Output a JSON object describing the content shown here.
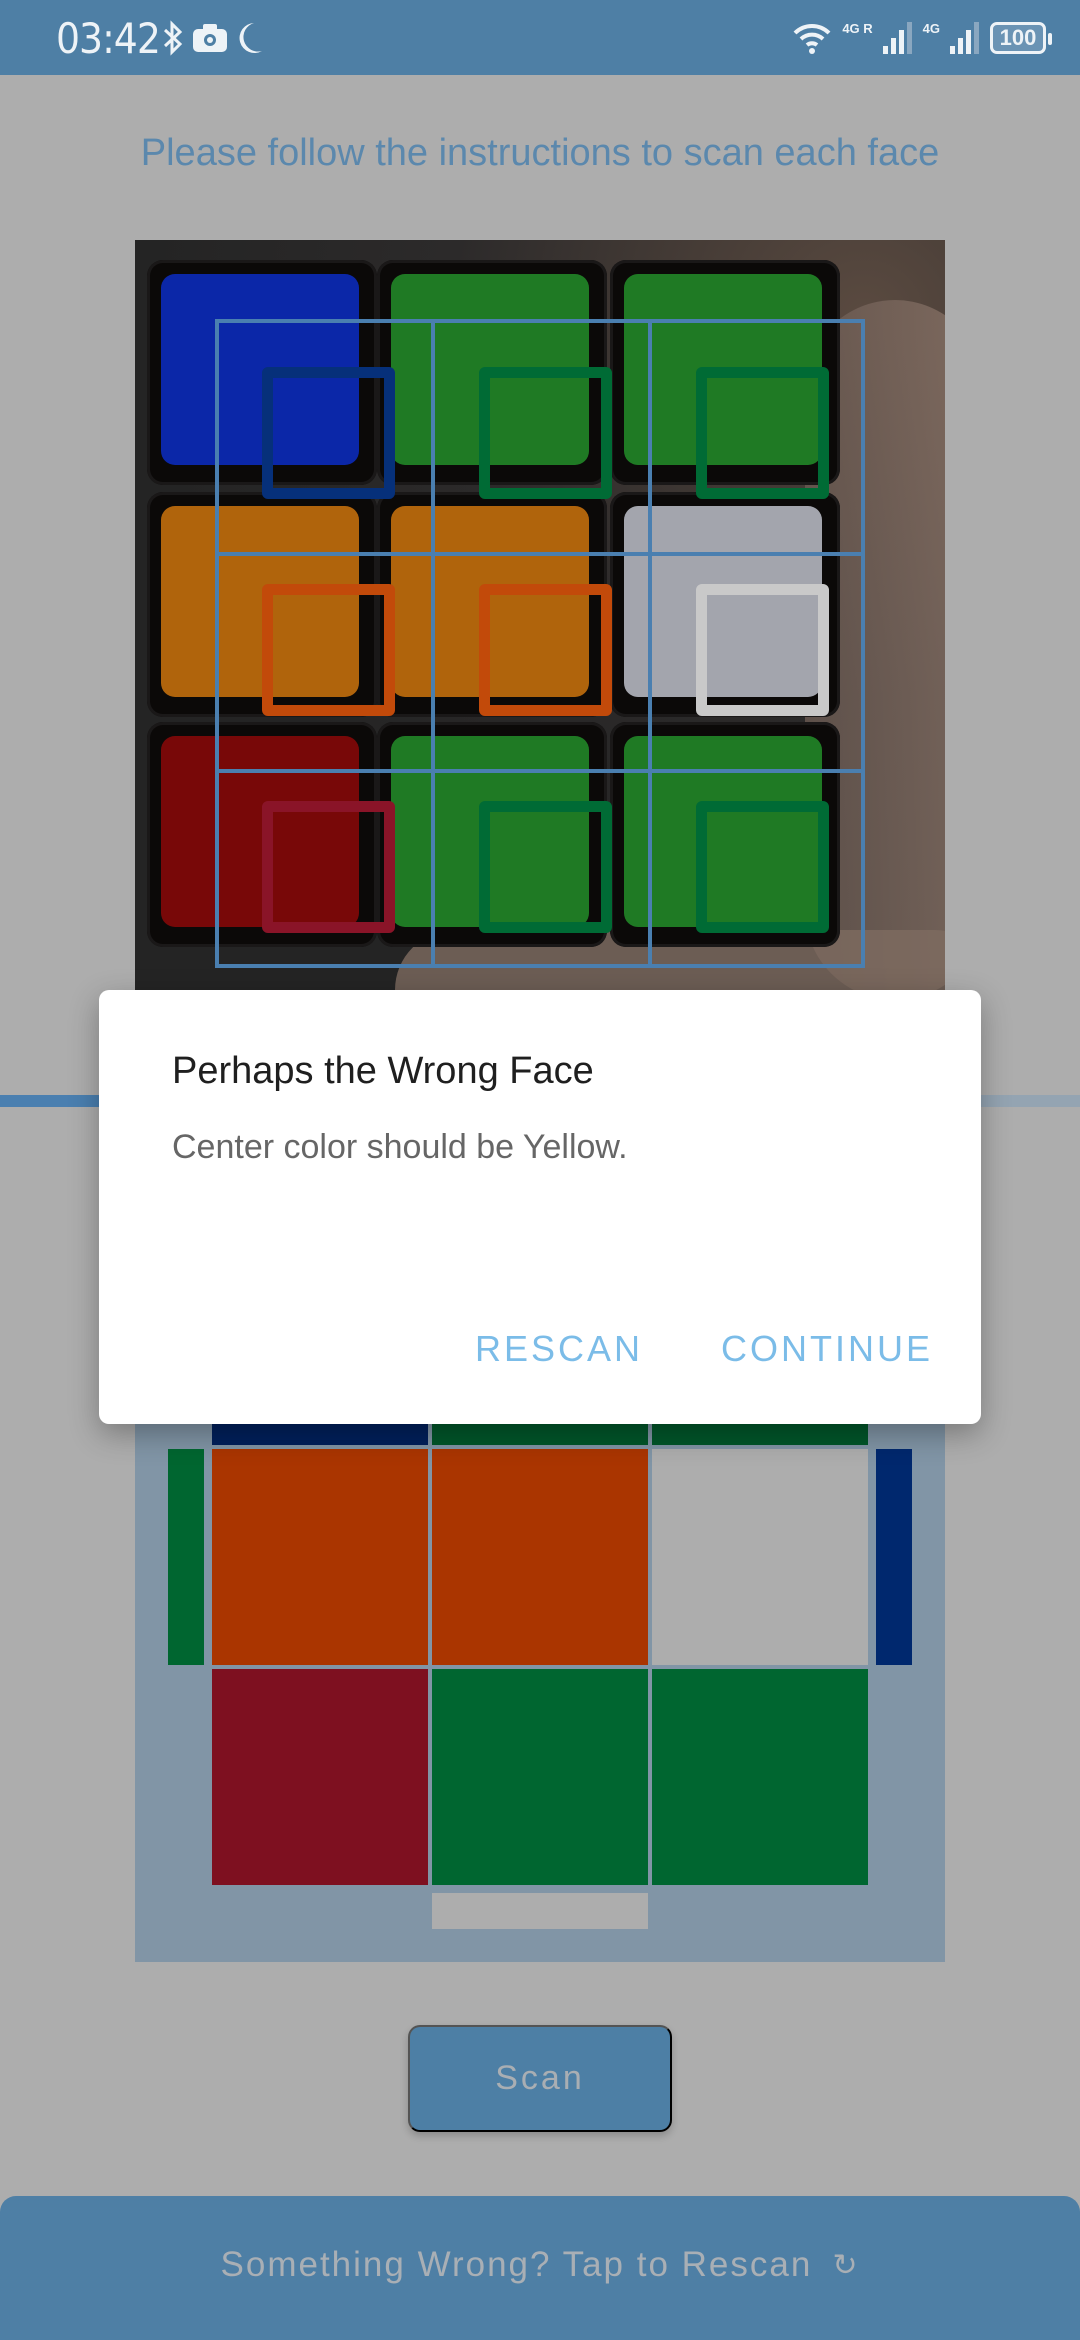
{
  "status_bar": {
    "time": "03:42",
    "left_icons": [
      "bluetooth-icon",
      "camera-icon",
      "do-not-disturb-moon-icon"
    ],
    "network1": "4G R",
    "network2": "4G",
    "battery": "100"
  },
  "instruction": "Please follow the instructions to scan each face",
  "camera": {
    "detected_colors": [
      [
        "blue",
        "green",
        "green"
      ],
      [
        "orange",
        "orange",
        "white"
      ],
      [
        "red",
        "green",
        "green"
      ]
    ],
    "sticker_colors": {
      "blue": "#0b27a8",
      "green": "#1f7a24",
      "orange": "#b0640c",
      "white": "#a3a5ad",
      "red": "#780808"
    },
    "marker_colors": {
      "blue": "#06307a",
      "green": "#006b35",
      "orange": "#c24a0a",
      "white": "#c9c9c9",
      "red": "#8a1428"
    }
  },
  "scan_progress": 0.5,
  "cube_net": {
    "top_row_colors": [
      "#00205c",
      "#00572a",
      "#00572a"
    ],
    "middle_row_colors": [
      "#aa3500",
      "#aa3500",
      "#adadad"
    ],
    "bottom_row_colors": [
      "#7e1020",
      "#006630",
      "#006630"
    ],
    "left_edge_color": "#006630",
    "right_edge_color": "#00286e",
    "bottom_edge_color": "#adadad"
  },
  "scan_button": "Scan",
  "bottom_bar": {
    "label": "Something Wrong? Tap to Rescan",
    "icon": "↻"
  },
  "dialog": {
    "title": "Perhaps the Wrong Face",
    "message": "Center color should be Yellow.",
    "rescan_label": "RESCAN",
    "continue_label": "CONTINUE"
  }
}
